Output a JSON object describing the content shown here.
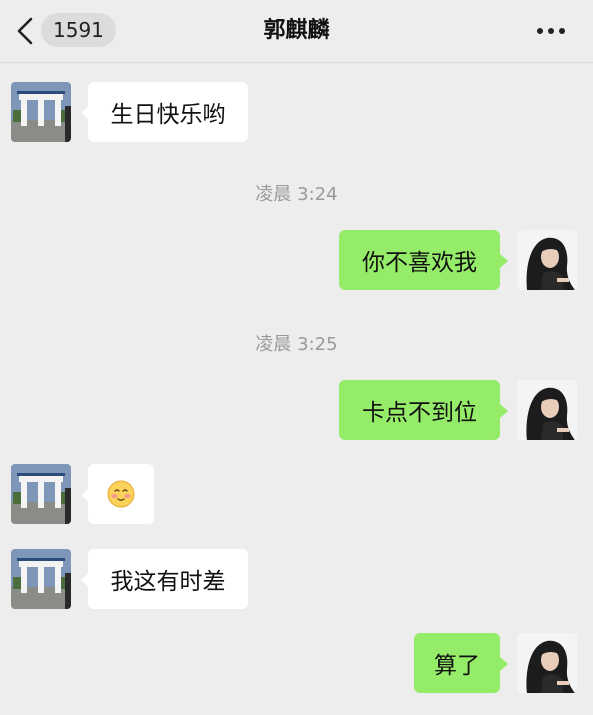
{
  "header": {
    "unread_count": "1591",
    "title": "郭麒麟",
    "more_icon": "more-dots-icon",
    "back_icon": "chevron-left-icon"
  },
  "messages": [
    {
      "side": "left",
      "text": "生日快乐哟",
      "avatar": "monument-gate-avatar"
    },
    {
      "type": "timestamp",
      "text": "凌晨 3:24"
    },
    {
      "side": "right",
      "text": "你不喜欢我",
      "avatar": "long-hair-girl-avatar"
    },
    {
      "type": "timestamp",
      "text": "凌晨 3:25"
    },
    {
      "side": "right",
      "text": "卡点不到位",
      "avatar": "long-hair-girl-avatar"
    },
    {
      "side": "left",
      "emoji": "flushed-smile-emoji",
      "avatar": "monument-gate-avatar"
    },
    {
      "side": "left",
      "text": "我这有时差",
      "avatar": "monument-gate-avatar"
    },
    {
      "side": "right",
      "text": "算了",
      "avatar": "long-hair-girl-avatar"
    }
  ],
  "colors": {
    "background": "#ededed",
    "bubble_left": "#ffffff",
    "bubble_right": "#95ec69",
    "timestamp": "#9a9a9a"
  }
}
